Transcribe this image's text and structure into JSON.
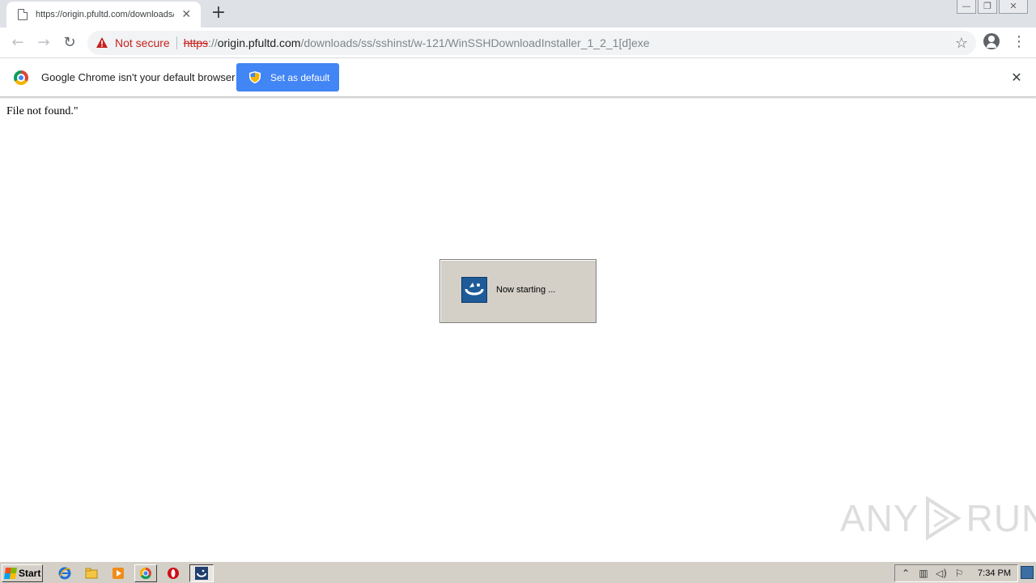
{
  "browser": {
    "tab_title": "https://origin.pfultd.com/downloads/ss/sshinst/w-121/WinSSHDownloadInstaller_1_2_1[d]exe",
    "new_tab_symbol": "+",
    "tab_close_symbol": "✕",
    "security_label": "Not secure",
    "url_scheme": "https",
    "url_separator": "://",
    "url_host": "origin.pfultd.com",
    "url_path": "/downloads/ss/sshinst/w-121/WinSSHDownloadInstaller_1_2_1[d]exe",
    "colors": {
      "insecure": "#c5221f",
      "tab_strip": "#dee1e6",
      "accent": "#4285f4"
    }
  },
  "infobar": {
    "message": "Google Chrome isn't your default browser",
    "button_label": "Set as default"
  },
  "page": {
    "body_text": "File not found.\""
  },
  "dialog": {
    "message": "Now starting ..."
  },
  "watermark": {
    "left": "ANY",
    "right": "RUN"
  },
  "taskbar": {
    "start_label": "Start",
    "clock": "7:34 PM",
    "pinned": [
      "ie-icon",
      "explorer-icon",
      "media-player-icon",
      "chrome-icon",
      "opera-icon",
      "winssh-icon"
    ]
  }
}
